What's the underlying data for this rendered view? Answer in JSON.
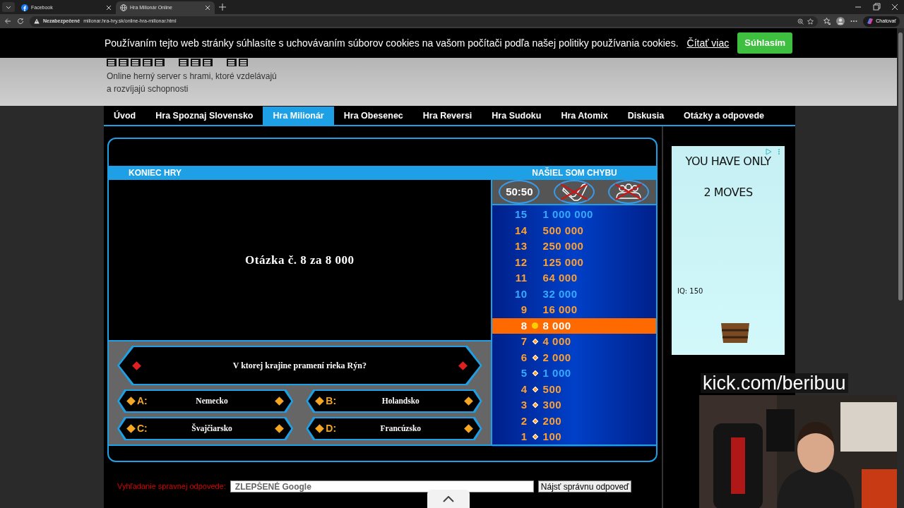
{
  "browser": {
    "tabs": [
      {
        "title": "Facebook",
        "selected": false
      },
      {
        "title": "Hra Milionár Online",
        "selected": true
      }
    ],
    "security": "Nezabezpečené",
    "url": "milionar.hra-hry.sk/online-hra-milionar.html",
    "chat_button": "Chatovať"
  },
  "cookie_bar": {
    "text": "Používaním tejto web stránky súhlasíte s uchovávaním súborov cookies na vašom počítači podľa našej politiky používania cookies.",
    "link": "Čítať viac",
    "button": "Súhlasím"
  },
  "header": {
    "tagline": [
      "Online herný server s hrami, ktoré vzdelávajú",
      "a rozvíjajú schopnosti"
    ]
  },
  "nav": [
    {
      "label": "Úvod",
      "selected": false
    },
    {
      "label": "Hra Spoznaj Slovensko",
      "selected": false
    },
    {
      "label": "Hra Milionár",
      "selected": true
    },
    {
      "label": "Hra Obesenec",
      "selected": false
    },
    {
      "label": "Hra Reversi",
      "selected": false
    },
    {
      "label": "Hra Sudoku",
      "selected": false
    },
    {
      "label": "Hra Atomix",
      "selected": false
    },
    {
      "label": "Diskusia",
      "selected": false
    },
    {
      "label": "Otázky a odpovede",
      "selected": false
    }
  ],
  "game": {
    "status": "KONIEC HRY",
    "report": "NAŠIEL SOM CHYBU",
    "screen_text": "Otázka č. 8 za 8 000",
    "question": "V ktorej krajine pramení rieka Rýn?",
    "answers": [
      {
        "letter": "A:",
        "text": "Nemecko"
      },
      {
        "letter": "B:",
        "text": "Holandsko"
      },
      {
        "letter": "C:",
        "text": "Švajčiarsko"
      },
      {
        "letter": "D:",
        "text": "Francúzsko"
      }
    ],
    "lifelines": [
      {
        "kind": "fifty",
        "label": "50:50",
        "used": false
      },
      {
        "kind": "phone",
        "used": true
      },
      {
        "kind": "audience",
        "used": true
      }
    ],
    "ladder": [
      {
        "number": "15",
        "amount": "1 000 000",
        "milestone": true,
        "reached": false,
        "selected": false
      },
      {
        "number": "14",
        "amount": "500 000",
        "milestone": false,
        "reached": false,
        "selected": false
      },
      {
        "number": "13",
        "amount": "250 000",
        "milestone": false,
        "reached": false,
        "selected": false
      },
      {
        "number": "12",
        "amount": "125 000",
        "milestone": false,
        "reached": false,
        "selected": false
      },
      {
        "number": "11",
        "amount": "64 000",
        "milestone": false,
        "reached": false,
        "selected": false
      },
      {
        "number": "10",
        "amount": "32 000",
        "milestone": true,
        "reached": false,
        "selected": false
      },
      {
        "number": "9",
        "amount": "16 000",
        "milestone": false,
        "reached": false,
        "selected": false
      },
      {
        "number": "8",
        "amount": "8 000",
        "selected": true
      },
      {
        "number": "7",
        "amount": "4 000",
        "milestone": false,
        "reached": true,
        "selected": false
      },
      {
        "number": "6",
        "amount": "2 000",
        "milestone": false,
        "reached": true,
        "selected": false
      },
      {
        "number": "5",
        "amount": "1 000",
        "milestone": true,
        "reached": true,
        "selected": false
      },
      {
        "number": "4",
        "amount": "500",
        "milestone": false,
        "reached": true,
        "selected": false
      },
      {
        "number": "3",
        "amount": "300",
        "milestone": false,
        "reached": true,
        "selected": false
      },
      {
        "number": "2",
        "amount": "200",
        "milestone": false,
        "reached": true,
        "selected": false
      },
      {
        "number": "1",
        "amount": "100",
        "milestone": false,
        "reached": true,
        "selected": false
      }
    ]
  },
  "search": {
    "label": "Vyhľadanie spravnej odpovede:",
    "placeholder": "ZLEPŠENÉ Google",
    "button": "Nájsť správnu odpoveď"
  },
  "ad": {
    "lines": [
      "YOU HAVE ONLY",
      "2 MOVES"
    ],
    "note": "IQ: 150"
  },
  "stream_overlay": {
    "text": "kick.com/beribuu"
  }
}
